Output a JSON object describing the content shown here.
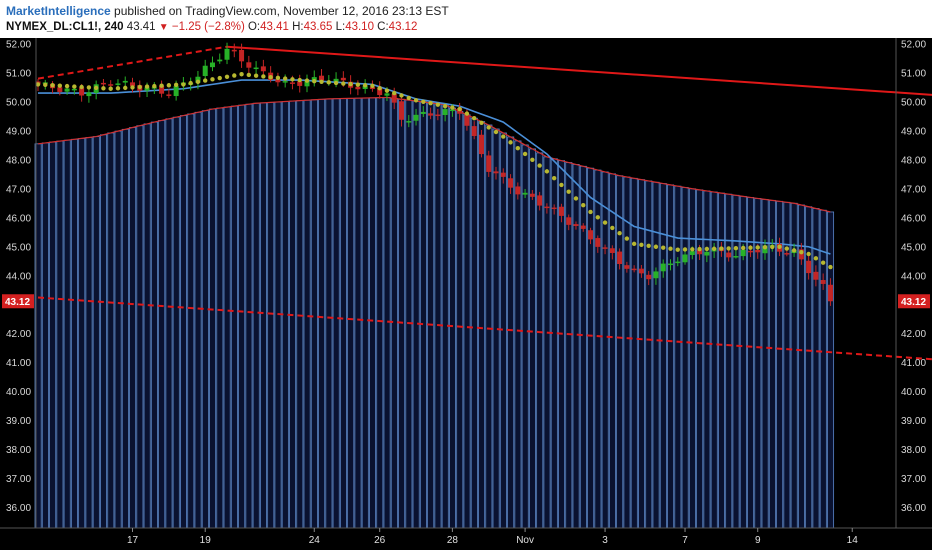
{
  "header": {
    "brand": "MarketIntelligence",
    "published": "published on TradingView.com, November 12, 2016 23:13 EST",
    "symbol": "NYMEX_DL:CL1!, 240",
    "last": "43.41",
    "change": "−1.25 (−2.8%)",
    "open_label": "O:",
    "open": "43.41",
    "high_label": "H:",
    "high": "43.65",
    "low_label": "L:",
    "low": "43.10",
    "close_label": "C:",
    "close": "43.12"
  },
  "colors": {
    "background": "#000000",
    "bull": "#27b227",
    "bear": "#c42525",
    "trendline": "#e01818",
    "ema_fast": "#b8b830",
    "ema_slow": "#4a8fd8",
    "hist": "#5b86c9",
    "hist_top": "#d03030"
  },
  "chart_data": {
    "type": "candlestick",
    "ylim": [
      35.3,
      52.2
    ],
    "y_ticks": [
      "52.00",
      "51.00",
      "50.00",
      "49.00",
      "48.00",
      "47.00",
      "46.00",
      "45.00",
      "44.00",
      "43.00",
      "42.00",
      "41.00",
      "40.00",
      "39.00",
      "38.00",
      "37.00",
      "36.00"
    ],
    "x_ticks": [
      "17",
      "19",
      "24",
      "26",
      "28",
      "Nov",
      "3",
      "7",
      "9",
      "14"
    ],
    "price_label": "43.12",
    "candle_count": 110,
    "anchors": [
      [
        0,
        50.6
      ],
      [
        6,
        50.3
      ],
      [
        10,
        50.7
      ],
      [
        14,
        50.5
      ],
      [
        18,
        50.3
      ],
      [
        22,
        50.9
      ],
      [
        26,
        51.8
      ],
      [
        30,
        51.1
      ],
      [
        34,
        50.6
      ],
      [
        40,
        50.8
      ],
      [
        44,
        50.5
      ],
      [
        48,
        50.3
      ],
      [
        50,
        49.4
      ],
      [
        54,
        49.6
      ],
      [
        58,
        49.7
      ],
      [
        62,
        47.7
      ],
      [
        66,
        46.9
      ],
      [
        70,
        46.4
      ],
      [
        74,
        45.7
      ],
      [
        78,
        44.9
      ],
      [
        82,
        44.1
      ],
      [
        84,
        44.0
      ],
      [
        88,
        44.6
      ],
      [
        92,
        44.9
      ],
      [
        96,
        44.7
      ],
      [
        100,
        45.0
      ],
      [
        104,
        44.8
      ],
      [
        108,
        43.6
      ],
      [
        109,
        43.12
      ]
    ],
    "ema_fast": [
      [
        0,
        50.6
      ],
      [
        10,
        50.45
      ],
      [
        20,
        50.6
      ],
      [
        28,
        50.95
      ],
      [
        36,
        50.75
      ],
      [
        46,
        50.55
      ],
      [
        52,
        50.05
      ],
      [
        58,
        49.75
      ],
      [
        64,
        48.8
      ],
      [
        70,
        47.6
      ],
      [
        76,
        46.2
      ],
      [
        82,
        45.1
      ],
      [
        88,
        44.9
      ],
      [
        96,
        44.95
      ],
      [
        102,
        45.0
      ],
      [
        106,
        44.75
      ],
      [
        109,
        44.3
      ]
    ],
    "ema_slow": [
      [
        0,
        50.3
      ],
      [
        10,
        50.3
      ],
      [
        20,
        50.45
      ],
      [
        28,
        50.75
      ],
      [
        36,
        50.75
      ],
      [
        46,
        50.6
      ],
      [
        52,
        50.1
      ],
      [
        58,
        49.85
      ],
      [
        64,
        49.3
      ],
      [
        70,
        48.2
      ],
      [
        76,
        46.7
      ],
      [
        82,
        45.7
      ],
      [
        88,
        45.3
      ],
      [
        96,
        45.2
      ],
      [
        102,
        45.1
      ],
      [
        106,
        45.0
      ],
      [
        109,
        44.75
      ]
    ],
    "hist_top": [
      [
        0,
        48.55
      ],
      [
        8,
        48.8
      ],
      [
        16,
        49.3
      ],
      [
        24,
        49.75
      ],
      [
        30,
        49.95
      ],
      [
        40,
        50.1
      ],
      [
        48,
        50.15
      ],
      [
        56,
        49.9
      ],
      [
        62,
        49.2
      ],
      [
        70,
        48.1
      ],
      [
        80,
        47.45
      ],
      [
        90,
        47.0
      ],
      [
        98,
        46.7
      ],
      [
        104,
        46.5
      ],
      [
        109,
        46.2
      ]
    ],
    "trend_upper_solid": [
      [
        26,
        51.9
      ],
      [
        130,
        50.12
      ]
    ],
    "trend_upper_dashed": [
      [
        0,
        50.8
      ],
      [
        26,
        51.9
      ]
    ],
    "trend_lower_dashed": [
      [
        0,
        43.25
      ],
      [
        130,
        41.0
      ]
    ]
  }
}
